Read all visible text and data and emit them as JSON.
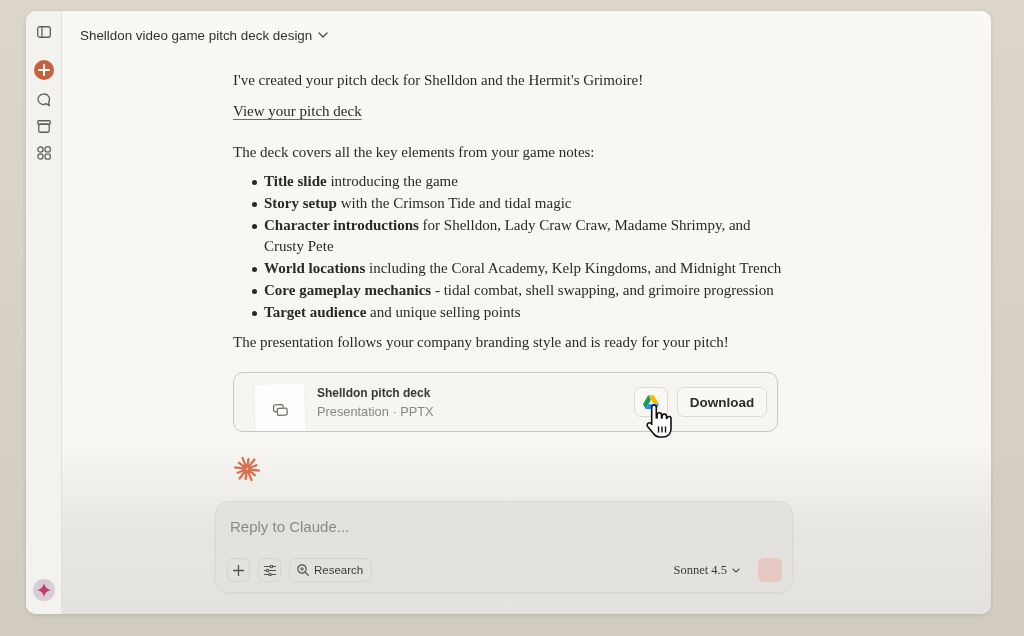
{
  "header": {
    "title": "Shelldon video game pitch deck design"
  },
  "message": {
    "intro": "I've created your pitch deck for Shelldon and the Hermit's Grimoire!",
    "link": "View your pitch deck",
    "lead": "The deck covers all the key elements from your game notes:",
    "bullets": [
      "**Title slide** introducing the game",
      "**Story setup** with the Crimson Tide and tidal magic",
      "**Character introductions** for Shelldon, Lady Craw Craw, Madame Shrimpy, and Crusty Pete",
      "**World locations** including the Coral Academy, Kelp Kingdoms, and Midnight Trench",
      "**Core gameplay mechanics** - tidal combat, shell swapping, and grimoire progression",
      "**Target audience** and unique selling points"
    ],
    "closing": "The presentation follows your company branding style and is ready for your pitch!"
  },
  "attachment": {
    "title": "Shelldon pitch deck",
    "subtitle": "Presentation · PPTX",
    "download": "Download"
  },
  "composer": {
    "placeholder": "Reply to Claude...",
    "research": "Research",
    "model": "Sonnet 4.5",
    "send": {
      "disabled": true
    }
  }
}
